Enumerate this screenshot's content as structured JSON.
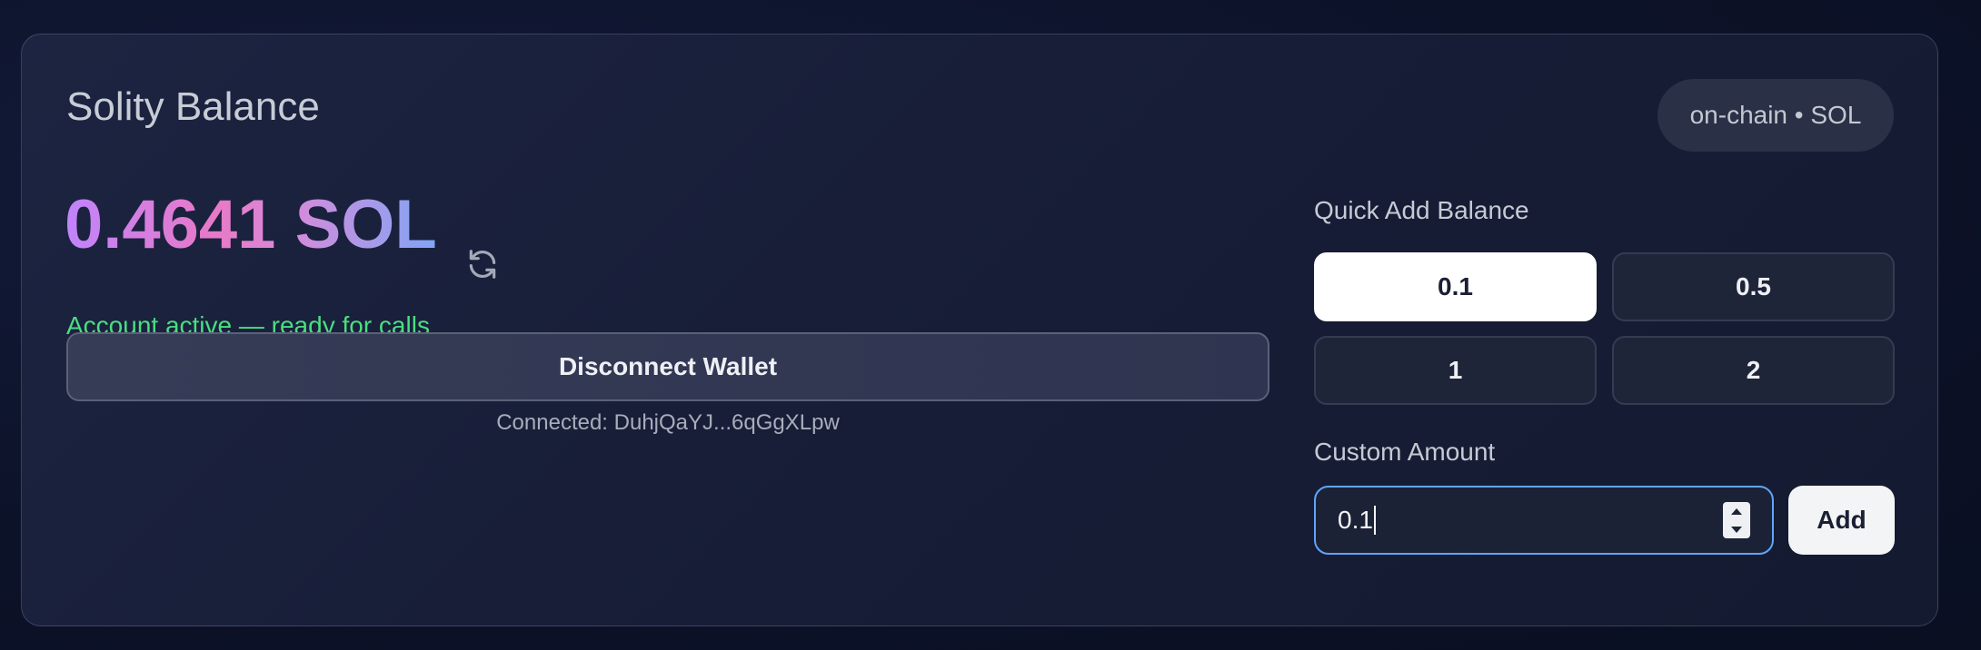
{
  "card": {
    "title": "Solity Balance",
    "badge": "on-chain • SOL"
  },
  "balance": {
    "amount": "0.4641 SOL",
    "status": "Account active — ready for calls",
    "refresh_icon": "refresh-icon"
  },
  "wallet": {
    "disconnect_label": "Disconnect Wallet",
    "connected_text": "Connected: DuhjQaYJ...6qGgXLpw"
  },
  "quick_add": {
    "label": "Quick Add Balance",
    "options": [
      "0.1",
      "0.5",
      "1",
      "2"
    ],
    "selected": "0.1"
  },
  "custom": {
    "label": "Custom Amount",
    "value": "0.1",
    "add_label": "Add"
  },
  "colors": {
    "status_green": "#4ade80",
    "focus_blue": "#60a5fa",
    "balance_gradient_start": "#c084fc",
    "balance_gradient_end": "#7fa6f5"
  }
}
